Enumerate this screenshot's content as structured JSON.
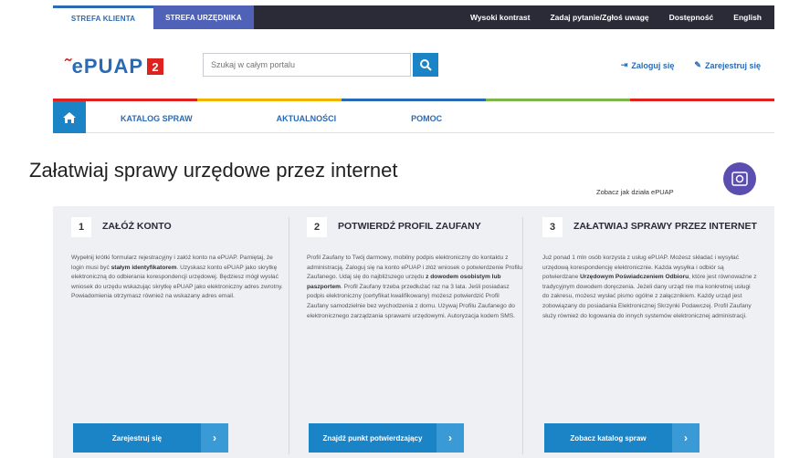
{
  "topbar": {
    "client_zone": "Strefa klienta",
    "official_zone": "Strefa urzędnika",
    "links": [
      "Wysoki kontrast",
      "Zadaj pytanie/Zgłoś uwagę",
      "Dostępność",
      "English"
    ]
  },
  "header": {
    "logo_text": "ePUAP",
    "logo_badge": "2",
    "search_placeholder": "Szukaj w całym portalu",
    "login": "Zaloguj się",
    "register": "Zarejestruj się"
  },
  "nav": {
    "items": [
      "KATALOG SPRAW",
      "AKTUALNOŚCI",
      "POMOC"
    ],
    "strip_colors": [
      "#e0221e",
      "#f0b400",
      "#2a6ab4",
      "#7ab648",
      "#e0221e"
    ]
  },
  "main": {
    "title": "Załatwiaj sprawy urzędowe przez internet",
    "guide_label": "Zobacz jak działa ePUAP"
  },
  "cards": [
    {
      "num": "1",
      "title": "ZAŁÓŻ KONTO",
      "body_1": "Wypełnij krótki formularz rejestracyjny i załóż konto na ePUAP. Pamiętaj, że login musi być ",
      "body_bold": "stałym identyfikatorem",
      "body_2": ". Uzyskasz konto ePUAP jako skrytkę elektroniczną do odbierania korespondencji urzędowej. Będziesz mógł wysłać wniosek do urzędu wskazując skrytkę ePUAP jako elektroniczny adres zwrotny. Powiadomienia otrzymasz również na wskazany adres email.",
      "cta": "Zarejestruj się"
    },
    {
      "num": "2",
      "title": "POTWIERDŹ PROFIL ZAUFANY",
      "body_1": "Profil Zaufany to Twój darmowy, mobilny podpis elektroniczny do kontaktu z administracją. Zaloguj się na konto ePUAP i złóż wniosek o potwierdzenie Profilu Zaufanego. Udaj się do najbliższego urzędu ",
      "body_bold": "z dowodem osobistym lub paszportem",
      "body_2": ". Profil Zaufany trzeba przedłużać raz na 3 lata. Jeśli posiadasz podpis elektroniczny (certyfikat kwalifikowany) możesz potwierdzić Profil Zaufany samodzielnie bez wychodzenia z domu. Używaj Profilu Zaufanego do elektronicznego zarządzania sprawami urzędowymi. Autoryzacja kodem SMS.",
      "cta": "Znajdź punkt potwierdzający"
    },
    {
      "num": "3",
      "title": "ZAŁATWIAJ SPRAWY PRZEZ INTERNET",
      "body_1": "Już ponad 1 mln osób korzysta z usług ePUAP. Możesz składać i wysyłać urzędową korespondencję elektronicznie. Każda wysyłka i odbiór są potwierdzane ",
      "body_bold": "Urzędowym Poświadczeniem Odbioru",
      "body_2": ", które jest równoważne z tradycyjnym dowodem doręczenia. Jeżeli dany urząd nie ma konkretnej usługi do zakresu, możesz wysłać pismo ogólne z załącznikiem. Każdy urząd jest zobowiązany do posiadania Elektronicznej Skrzynki Podawczej. Profil Zaufany służy również do logowania do innych systemów elektronicznej administracji.",
      "cta": "Zobacz katalog spraw"
    }
  ],
  "colors": {
    "primary": "#1a84c7",
    "dark": "#2b2b38",
    "brand_red": "#e0221e"
  }
}
